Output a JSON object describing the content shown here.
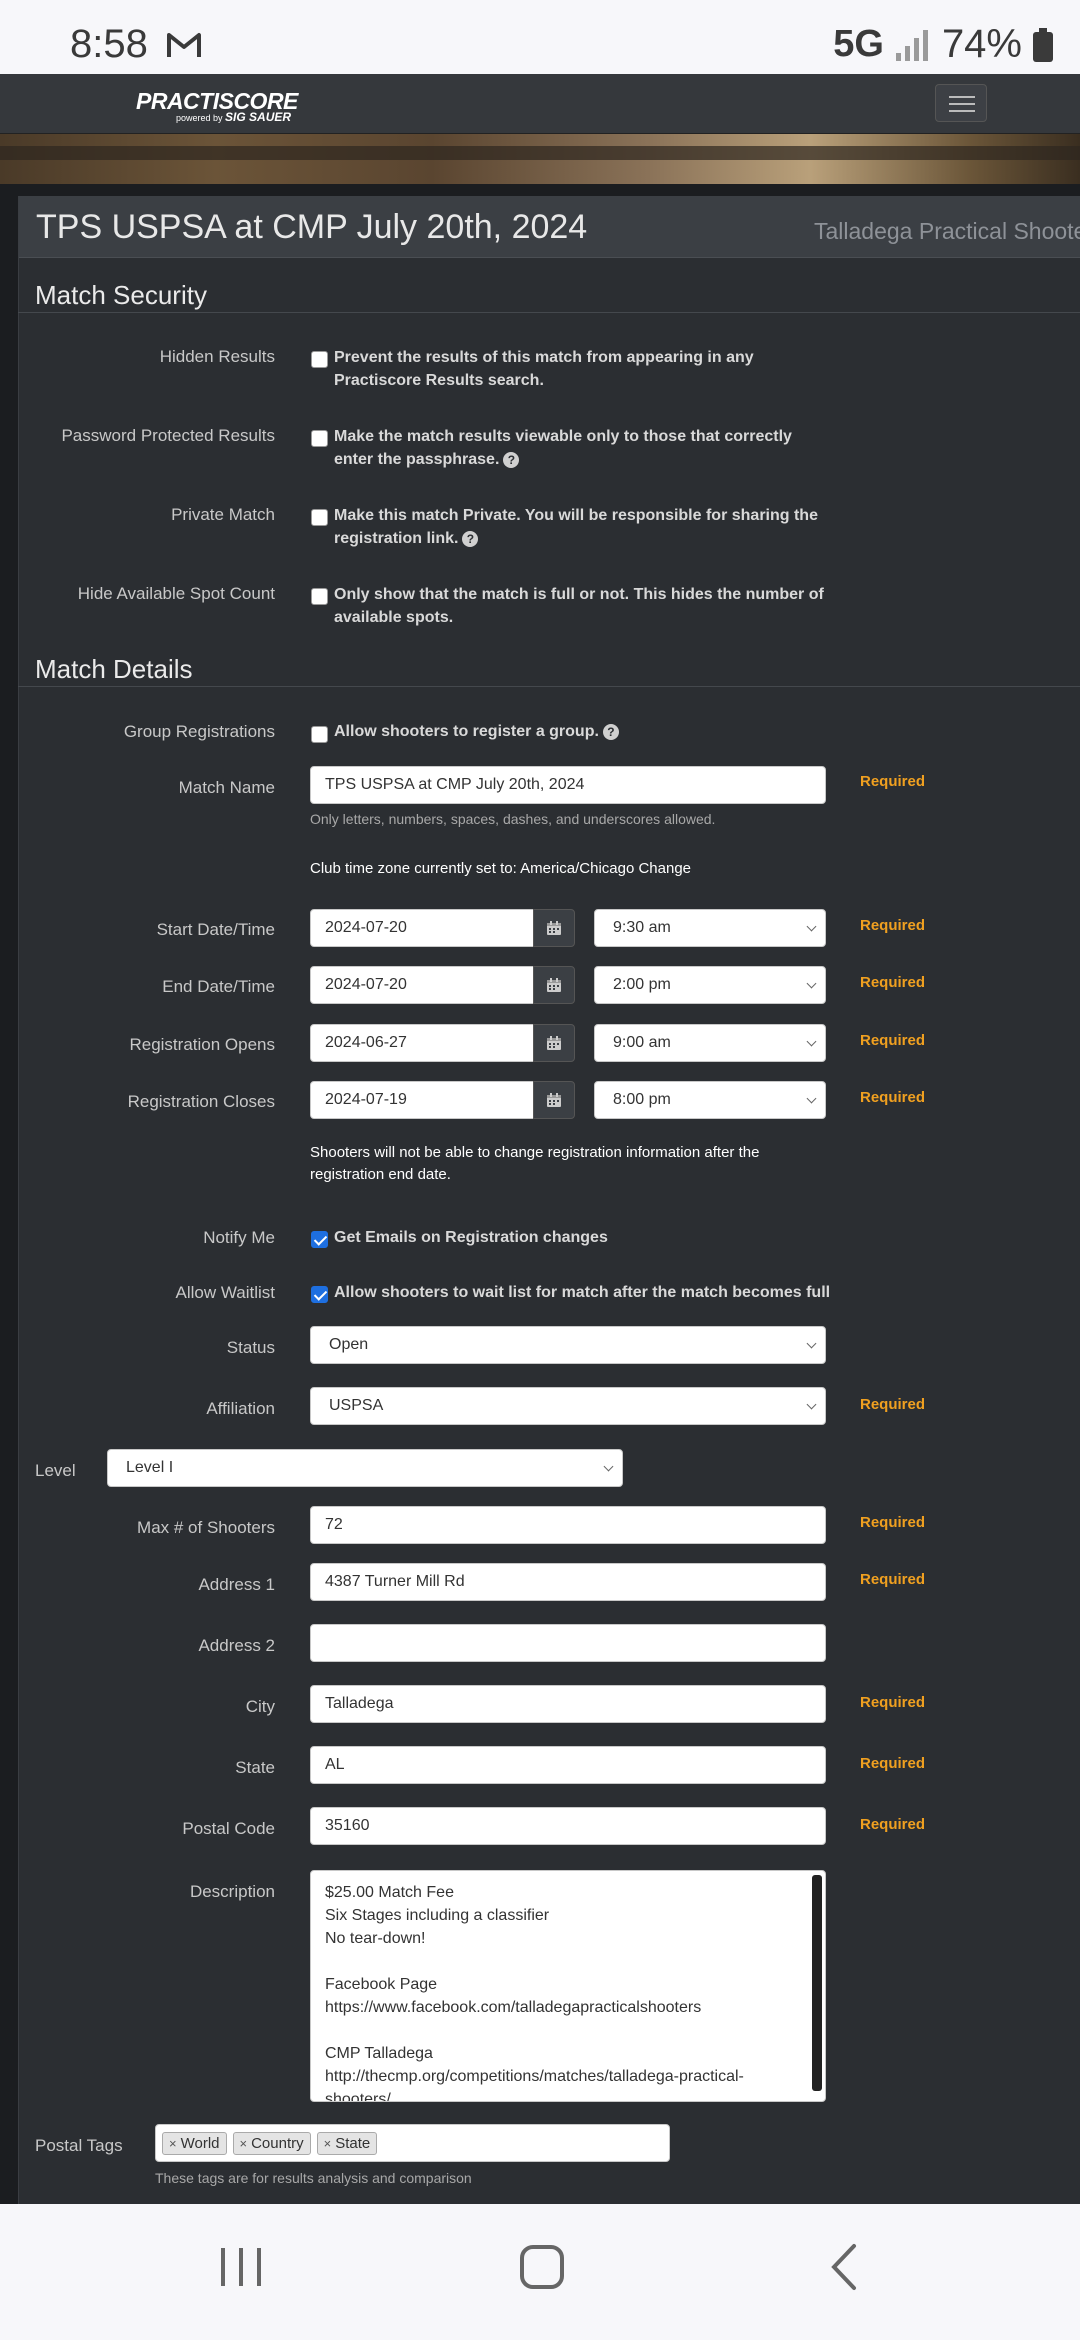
{
  "status_bar": {
    "time": "8:58",
    "network": "5G",
    "battery": "74%"
  },
  "navbar": {
    "logo_main": "PRACTISCORE",
    "logo_sub": "powered by",
    "logo_brand": "SIG SAUER"
  },
  "page": {
    "title": "TPS USPSA at CMP July 20th, 2024",
    "club": "Talladega Practical Shooters"
  },
  "security": {
    "heading": "Match Security",
    "rows": [
      {
        "label": "Hidden Results",
        "text": "Prevent the results of this match from appearing in any Practiscore Results search.",
        "checked": false
      },
      {
        "label": "Password Protected Results",
        "text": "Make the match results viewable only to those that correctly enter the passphrase.",
        "checked": false
      },
      {
        "label": "Private Match",
        "text": "Make this match Private. You will be responsible for sharing the registration link.",
        "checked": false
      },
      {
        "label": "Hide Available Spot Count",
        "text": "Only show that the match is full or not. This hides the number of available spots.",
        "checked": false
      }
    ]
  },
  "details": {
    "heading": "Match Details",
    "group_reg": {
      "label": "Group Registrations",
      "text": "Allow shooters to register a group."
    },
    "match_name": {
      "label": "Match Name",
      "value": "TPS USPSA at CMP July 20th, 2024",
      "hint": "Only letters, numbers, spaces, dashes, and underscores allowed."
    },
    "timezone_note": "Club time zone currently set to: America/Chicago Change",
    "required": "Required",
    "dates": [
      {
        "label": "Start Date/Time",
        "date": "2024-07-20",
        "time": "9:30 am"
      },
      {
        "label": "End Date/Time",
        "date": "2024-07-20",
        "time": "2:00 pm"
      },
      {
        "label": "Registration Opens",
        "date": "2024-06-27",
        "time": "9:00 am"
      },
      {
        "label": "Registration Closes",
        "date": "2024-07-19",
        "time": "8:00 pm"
      }
    ],
    "reg_note": "Shooters will not be able to change registration information after the registration end date.",
    "notify": {
      "label": "Notify Me",
      "text": "Get Emails on Registration changes",
      "checked": true
    },
    "waitlist": {
      "label": "Allow Waitlist",
      "text": "Allow shooters to wait list for match after the match becomes full",
      "checked": true
    },
    "status": {
      "label": "Status",
      "value": "Open"
    },
    "affiliation": {
      "label": "Affiliation",
      "value": "USPSA"
    },
    "level": {
      "label": "Level",
      "value": "Level I"
    },
    "max_shooters": {
      "label": "Max # of Shooters",
      "value": "72"
    },
    "address1": {
      "label": "Address 1",
      "value": "4387 Turner Mill Rd"
    },
    "address2": {
      "label": "Address 2",
      "value": ""
    },
    "city": {
      "label": "City",
      "value": "Talladega"
    },
    "state": {
      "label": "State",
      "value": "AL"
    },
    "postal": {
      "label": "Postal Code",
      "value": "35160"
    },
    "description": {
      "label": "Description",
      "lines": [
        "$25.00 Match Fee",
        "Six Stages including a classifier",
        "No tear-down!",
        "",
        "Facebook Page",
        "https://www.facebook.com/talladegapracticalshooters",
        "",
        "CMP Talladega",
        "http://thecmp.org/competitions/matches/talladega-practical-",
        "shooters/"
      ]
    },
    "postal_tags": {
      "label": "Postal Tags",
      "tags": [
        "World",
        "Country",
        "State"
      ],
      "hint": "These tags are for results analysis and comparison"
    }
  }
}
